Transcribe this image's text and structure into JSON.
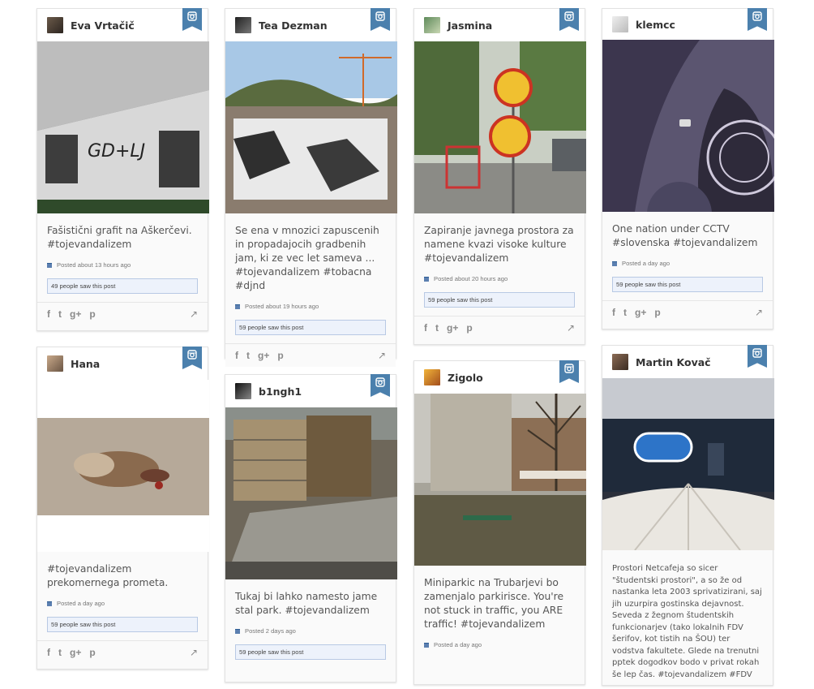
{
  "cards": [
    {
      "author": "Eva Vrtačič",
      "caption": "Fašistični grafit na Aškerčevi. #tojevandalizem",
      "posted": "Posted about 13 hours ago",
      "seen": "49 people saw this post"
    },
    {
      "author": "Tea Dezman",
      "caption": "Se ena v mnozici zapuscenih in propadajocih gradbenih jam, ki ze vec let sameva ... #tojevandalizem #tobacna #djnd",
      "posted": "Posted about 19 hours ago",
      "seen": "59 people saw this post"
    },
    {
      "author": "Jasmina",
      "caption": "Zapiranje javnega prostora za namene kvazi visoke kulture #tojevandalizem",
      "posted": "Posted about 20 hours ago",
      "seen": "59 people saw this post"
    },
    {
      "author": "klemcc",
      "caption": "One nation under CCTV #slovenska #tojevandalizem",
      "posted": "Posted a day ago",
      "seen": "59 people saw this post"
    },
    {
      "author": "Hana",
      "caption": "#tojevandalizem prekomernega prometa.",
      "posted": "Posted a day ago",
      "seen": "59 people saw this post"
    },
    {
      "author": "b1ngh1",
      "caption": "Tukaj bi lahko namesto jame stal park. #tojevandalizem",
      "posted": "Posted 2 days ago",
      "seen": "59 people saw this post"
    },
    {
      "author": "Zigolo",
      "caption": "Miniparkic na Trubarjevi bo zamenjalo parkirisce. You're not stuck in traffic, you ARE traffic! #tojevandalizem",
      "posted": "Posted a day ago",
      "seen": ""
    },
    {
      "author": "Martin Kovač",
      "caption": "Prostori Netcafeja so sicer \"študentski prostori\", a so že od nastanka leta 2003 sprivatizirani, saj jih uzurpira gostinska dejavnost. Seveda z žegnom študentskih funkcionarjev (tako lokalnih FDV šerifov, kot tistih na ŠOU) ter vodstva fakultete. Glede na trenutni pptek dogodkov bodo v privat rokah še lep čas. #tojevandalizem #FDV",
      "posted": "",
      "seen": ""
    }
  ],
  "icons": {
    "ribbon": "instagram-icon",
    "facebook": "f",
    "twitter": "t",
    "google": "g+",
    "pinterest": "p",
    "external": "external-link-icon",
    "calendar": "calendar-icon"
  },
  "colors": {
    "accent": "#4b80ad",
    "seen_bg": "#edf2fb"
  }
}
